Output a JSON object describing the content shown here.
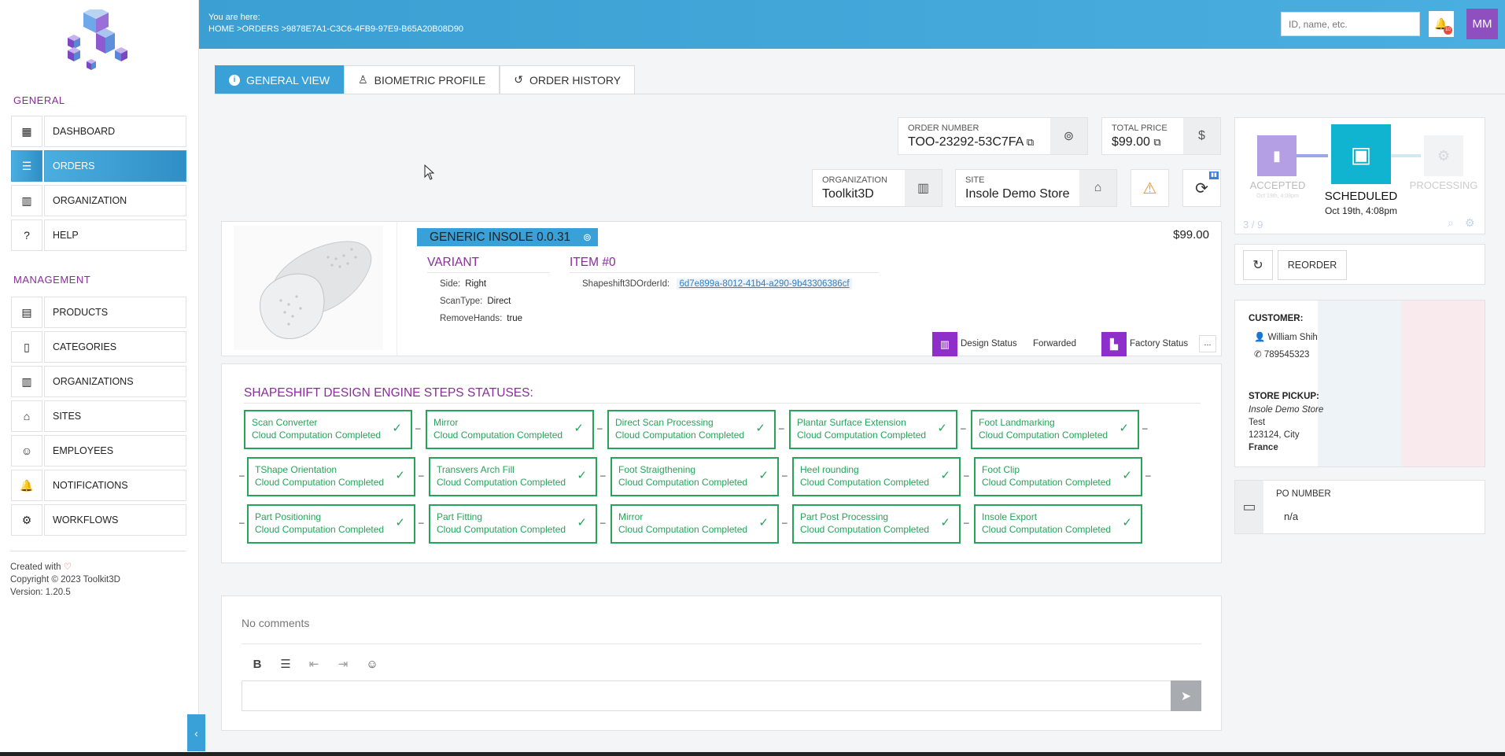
{
  "sidebar": {
    "general_title": "GENERAL",
    "management_title": "MANAGEMENT",
    "general_items": [
      {
        "label": "DASHBOARD"
      },
      {
        "label": "ORDERS"
      },
      {
        "label": "ORGANIZATION"
      },
      {
        "label": "HELP"
      }
    ],
    "management_items": [
      {
        "label": "PRODUCTS"
      },
      {
        "label": "CATEGORIES"
      },
      {
        "label": "ORGANIZATIONS"
      },
      {
        "label": "SITES"
      },
      {
        "label": "EMPLOYEES"
      },
      {
        "label": "NOTIFICATIONS"
      },
      {
        "label": "WORKFLOWS"
      }
    ],
    "created_with": "Created with",
    "copyright": "Copyright © 2023 Toolkit3D",
    "version": "Version: 1.20.5"
  },
  "header": {
    "you_are_here": "You are here:",
    "breadcrumb": "HOME >ORDERS >9878E7A1-C3C6-4FB9-97E9-B65A20B08D90",
    "search_placeholder": "ID, name, etc.",
    "notification_count": "10",
    "avatar_initials": "MM"
  },
  "tabs": [
    {
      "label": "GENERAL VIEW"
    },
    {
      "label": "BIOMETRIC PROFILE"
    },
    {
      "label": "ORDER HISTORY"
    }
  ],
  "order": {
    "order_number_label": "ORDER NUMBER",
    "order_number": "TOO-23292-53C7FA",
    "total_price_label": "TOTAL PRICE",
    "total_price": "$99.00",
    "organization_label": "ORGANIZATION",
    "organization": "Toolkit3D",
    "site_label": "SITE",
    "site": "Insole Demo Store"
  },
  "workflow": {
    "accepted_label": "ACCEPTED",
    "accepted_date": "Oct 19th, 4:08pm",
    "scheduled_label": "SCHEDULED",
    "scheduled_date": "Oct 19th, 4:08pm",
    "processing_label": "PROCESSING",
    "step_counter": "3 / 9",
    "reorder_label": "REORDER"
  },
  "customer": {
    "customer_label": "CUSTOMER:",
    "name": "William Shih",
    "phone": "789545323",
    "pickup_label": "STORE PICKUP:",
    "store": "Insole Demo Store",
    "line1": "Test",
    "line2": "123124, City",
    "country": "France",
    "po_label": "PO NUMBER",
    "po_value": "n/a"
  },
  "item": {
    "product_title": "GENERIC INSOLE 0.0.31",
    "price": "$99.00",
    "variant_title": "VARIANT",
    "item_title": "ITEM #0",
    "side_label": "Side:",
    "side": "Right",
    "scantype_label": "ScanType:",
    "scantype": "Direct",
    "removehands_label": "RemoveHands:",
    "removehands": "true",
    "shapeshift_label": "Shapeshift3DOrderId:",
    "shapeshift_id": "6d7e899a-8012-41b4-a290-9b43306386cf",
    "design_status_label": "Design Status",
    "design_status": "Forwarded",
    "factory_status_label": "Factory Status",
    "more": "..."
  },
  "steps": {
    "title": "SHAPESHIFT DESIGN ENGINE STEPS STATUSES:",
    "status": "Cloud Computation Completed",
    "rows": [
      [
        "Scan Converter",
        "Mirror",
        "Direct Scan Processing",
        "Plantar Surface Extension",
        "Foot Landmarking"
      ],
      [
        "TShape Orientation",
        "Transvers Arch Fill",
        "Foot Straigthening",
        "Heel rounding",
        "Foot Clip"
      ],
      [
        "Part Positioning",
        "Part Fitting",
        "Mirror",
        "Part Post Processing",
        "Insole Export"
      ]
    ]
  },
  "comments": {
    "placeholder": "No comments"
  },
  "colors": {
    "primary": "#3aa0d8",
    "brand_purple": "#8a2c9c",
    "success_green": "#27a35a",
    "scheduled_teal": "#10b3d0",
    "warning_orange": "#f0932b"
  }
}
